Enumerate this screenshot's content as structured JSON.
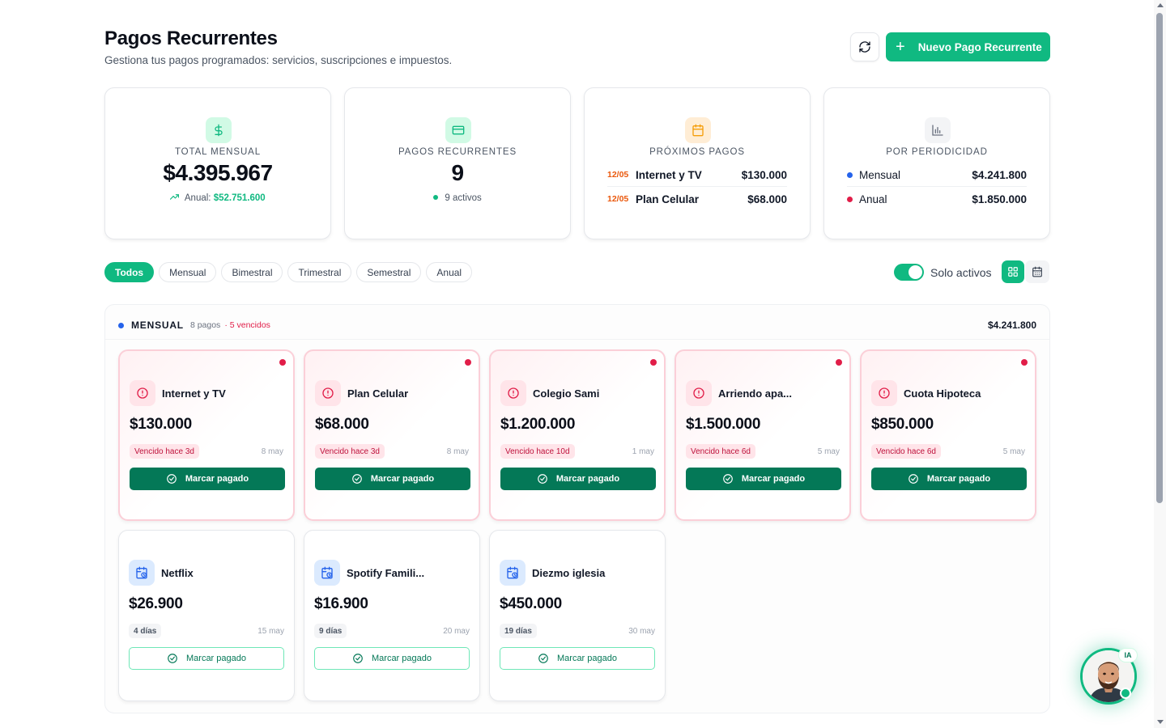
{
  "header": {
    "title": "Pagos Recurrentes",
    "subtitle": "Gestiona tus pagos programados: servicios, suscripciones e impuestos.",
    "new_button": "Nuevo Pago Recurrente"
  },
  "stats": {
    "total": {
      "label": "TOTAL MENSUAL",
      "value": "$4.395.967",
      "annual_label": "Anual:",
      "annual_value": "$52.751.600"
    },
    "count": {
      "label": "PAGOS RECURRENTES",
      "value": "9",
      "active": "9 activos"
    },
    "upcoming": {
      "label": "PRÓXIMOS PAGOS",
      "items": [
        {
          "date": "12/05",
          "name": "Internet y TV",
          "amount": "$130.000"
        },
        {
          "date": "12/05",
          "name": "Plan Celular",
          "amount": "$68.000"
        }
      ]
    },
    "periodicity": {
      "label": "POR PERIODICIDAD",
      "items": [
        {
          "name": "Mensual",
          "amount": "$4.241.800",
          "color": "#2563eb"
        },
        {
          "name": "Anual",
          "amount": "$1.850.000",
          "color": "#e11d48"
        }
      ]
    }
  },
  "filters": {
    "chips": [
      "Todos",
      "Mensual",
      "Bimestral",
      "Trimestral",
      "Semestral",
      "Anual"
    ],
    "active": "Todos",
    "only_active_label": "Solo activos",
    "only_active": true
  },
  "group": {
    "name": "MENSUAL",
    "count": "8 pagos",
    "overdue": "· 5 vencidos",
    "total": "$4.241.800",
    "color": "#2563eb"
  },
  "payments": [
    {
      "name": "Internet y TV",
      "amount": "$130.000",
      "badge": "Vencido hace 3d",
      "date": "8 may",
      "overdue": true,
      "button": "Marcar pagado"
    },
    {
      "name": "Plan Celular",
      "amount": "$68.000",
      "badge": "Vencido hace 3d",
      "date": "8 may",
      "overdue": true,
      "button": "Marcar pagado"
    },
    {
      "name": "Colegio Sami",
      "amount": "$1.200.000",
      "badge": "Vencido hace 10d",
      "date": "1 may",
      "overdue": true,
      "button": "Marcar pagado"
    },
    {
      "name": "Arriendo apa...",
      "amount": "$1.500.000",
      "badge": "Vencido hace 6d",
      "date": "5 may",
      "overdue": true,
      "button": "Marcar pagado"
    },
    {
      "name": "Cuota Hipoteca",
      "amount": "$850.000",
      "badge": "Vencido hace 6d",
      "date": "5 may",
      "overdue": true,
      "button": "Marcar pagado"
    },
    {
      "name": "Netflix",
      "amount": "$26.900",
      "badge": "4 días",
      "date": "15 may",
      "overdue": false,
      "button": "Marcar pagado"
    },
    {
      "name": "Spotify Famili...",
      "amount": "$16.900",
      "badge": "9 días",
      "date": "20 may",
      "overdue": false,
      "button": "Marcar pagado"
    },
    {
      "name": "Diezmo iglesia",
      "amount": "$450.000",
      "badge": "19 días",
      "date": "30 may",
      "overdue": false,
      "button": "Marcar pagado"
    }
  ],
  "assistant": {
    "badge": "IA"
  },
  "colors": {
    "accent": "#10b981",
    "accent_dark": "#047857",
    "danger": "#e11d48",
    "warning": "#ea580c"
  }
}
